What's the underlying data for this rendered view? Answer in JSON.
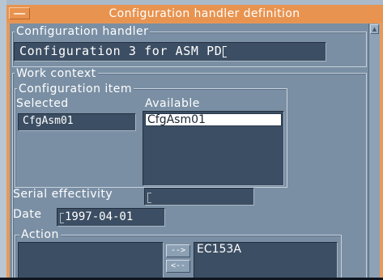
{
  "window": {
    "title": "Configuration handler definition"
  },
  "configuration_handler": {
    "legend": "Configuration handler",
    "value": "Configuration 3 for ASM PD"
  },
  "work_context": {
    "legend": "Work context",
    "configuration_item": {
      "legend": "Configuration item",
      "selected_header": "Selected",
      "available_header": "Available",
      "selected_items": [
        "CfgAsm01"
      ],
      "available_items": [
        "CfgAsm01"
      ]
    },
    "serial_effectivity": {
      "label": "Serial effectivity",
      "value": ""
    },
    "date": {
      "label": "Date",
      "value": "1997-04-01"
    },
    "action": {
      "legend": "Action",
      "add_button": "-->",
      "remove_button": "<--",
      "available_items": [
        "EC153A"
      ]
    }
  },
  "icons": {
    "window_menu": "window-menu-icon",
    "scroll_up": "scroll-up-arrow-icon"
  },
  "colors": {
    "titlebar": "#e8934f",
    "panel": "#7a8fa4",
    "field": "#3c4e63"
  }
}
